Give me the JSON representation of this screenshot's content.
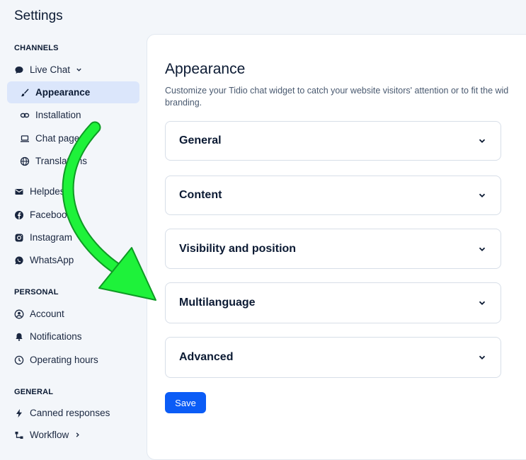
{
  "app": {
    "title": "Settings"
  },
  "sidebar": {
    "sections": [
      {
        "heading": "CHANNELS"
      },
      {
        "heading": "PERSONAL"
      },
      {
        "heading": "GENERAL"
      }
    ],
    "items": [
      {
        "label": "Live Chat",
        "icon": "chat-bubble-icon"
      },
      {
        "label": "Appearance",
        "icon": "brush-icon",
        "active": true
      },
      {
        "label": "Installation",
        "icon": "link-icon"
      },
      {
        "label": "Chat page",
        "icon": "laptop-icon"
      },
      {
        "label": "Translations",
        "icon": "globe-icon"
      },
      {
        "label": "Helpdesk",
        "icon": "mail-icon"
      },
      {
        "label": "Facebook",
        "icon": "facebook-icon"
      },
      {
        "label": "Instagram",
        "icon": "instagram-icon"
      },
      {
        "label": "WhatsApp",
        "icon": "whatsapp-icon"
      },
      {
        "label": "Account",
        "icon": "user-icon"
      },
      {
        "label": "Notifications",
        "icon": "bell-icon"
      },
      {
        "label": "Operating hours",
        "icon": "clock-icon"
      },
      {
        "label": "Canned responses",
        "icon": "lightning-icon"
      },
      {
        "label": "Workflow",
        "icon": "workflow-icon"
      }
    ]
  },
  "main": {
    "title": "Appearance",
    "description": "Customize your Tidio chat widget to catch your website visitors' attention or to fit the wid branding.",
    "panels": [
      {
        "label": "General"
      },
      {
        "label": "Content"
      },
      {
        "label": "Visibility and position"
      },
      {
        "label": "Multilanguage"
      },
      {
        "label": "Advanced"
      }
    ],
    "save_label": "Save"
  },
  "colors": {
    "accent": "#0b5cf6",
    "active_bg": "#dbe6fb",
    "annotation_arrow": "#1ef23a"
  }
}
